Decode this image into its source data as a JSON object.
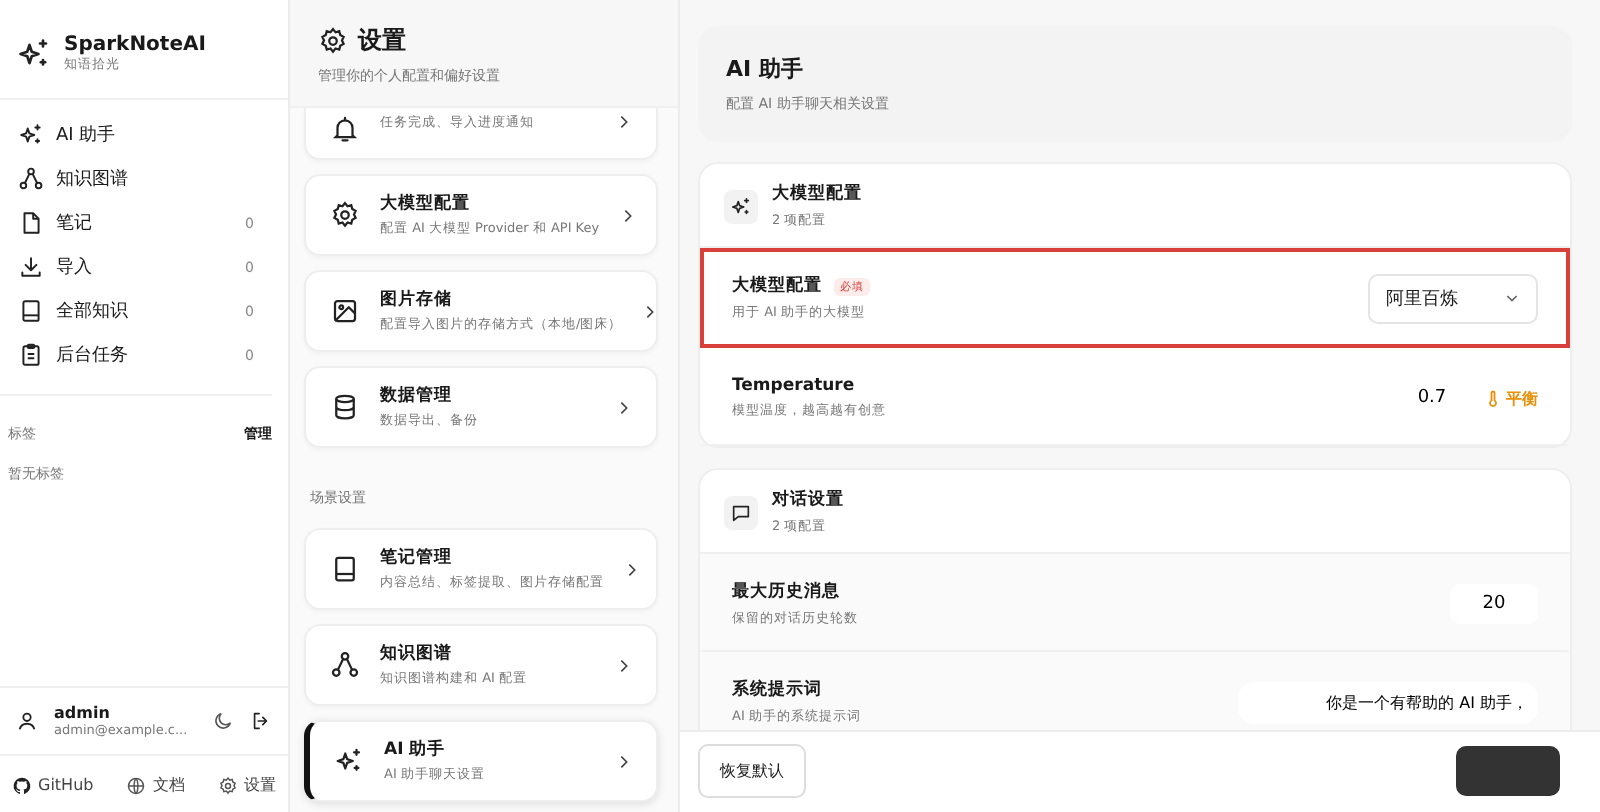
{
  "sidebar": {
    "app_name": "SparkNoteAI",
    "tagline": "知语拾光",
    "nav": [
      {
        "label": "AI 助手"
      },
      {
        "label": "知识图谱"
      },
      {
        "label": "笔记",
        "count": "0"
      },
      {
        "label": "导入",
        "count": "0"
      },
      {
        "label": "全部知识",
        "count": "0"
      },
      {
        "label": "后台任务",
        "count": "0"
      }
    ],
    "tags": {
      "title": "标签",
      "action": "管理",
      "empty": "暂无标签"
    },
    "user": {
      "name": "admin",
      "email": "admin@example.c..."
    },
    "footer_links": [
      "GitHub",
      "文档",
      "设置"
    ]
  },
  "settings_nav": {
    "title": "设置",
    "subtitle": "管理你的个人配置和偏好设置",
    "groups": [
      {
        "items": [
          {
            "subtitle": "任务完成、导入进度通知",
            "selected": false
          },
          {
            "title": "大模型配置",
            "subtitle": "配置 AI 大模型 Provider 和 API Key",
            "selected": false
          },
          {
            "title": "图片存储",
            "subtitle": "配置导入图片的存储方式（本地/图床）",
            "selected": false
          },
          {
            "title": "数据管理",
            "subtitle": "数据导出、备份",
            "selected": false
          }
        ]
      },
      {
        "label": "场景设置",
        "items": [
          {
            "title": "笔记管理",
            "subtitle": "内容总结、标签提取、图片存储配置",
            "selected": false
          },
          {
            "title": "知识图谱",
            "subtitle": "知识图谱构建和 AI 配置",
            "selected": false
          },
          {
            "title": "AI 助手",
            "subtitle": "AI 助手聊天设置",
            "selected": true
          }
        ]
      }
    ]
  },
  "content": {
    "title": "AI 助手",
    "subtitle": "配置 AI 助手聊天相关设置",
    "sections": [
      {
        "title": "大模型配置",
        "count": "2 项配置",
        "rows": [
          {
            "kind": "select",
            "label": "大模型配置",
            "badge": "必填",
            "description": "用于 AI 助手的大模型",
            "value": "阿里百炼",
            "highlighted": true
          },
          {
            "kind": "number",
            "label": "Temperature",
            "description": "模型温度，越高越有创意",
            "value": "0.7",
            "hint": "平衡",
            "highlighted": false
          }
        ]
      },
      {
        "title": "对话设置",
        "count": "2 项配置",
        "rows": [
          {
            "kind": "number",
            "label": "最大历史消息",
            "description": "保留的对话历史轮数",
            "value": "20",
            "highlighted": false
          },
          {
            "kind": "text",
            "label": "系统提示词",
            "description": "AI 助手的系统提示词",
            "value": "你是一个有帮助的 AI 助手，",
            "highlighted": false
          }
        ]
      }
    ]
  },
  "footer": {
    "buttons": [
      {
        "kind": "secondary",
        "label": "恢复默认"
      },
      {
        "kind": "primary"
      }
    ]
  }
}
